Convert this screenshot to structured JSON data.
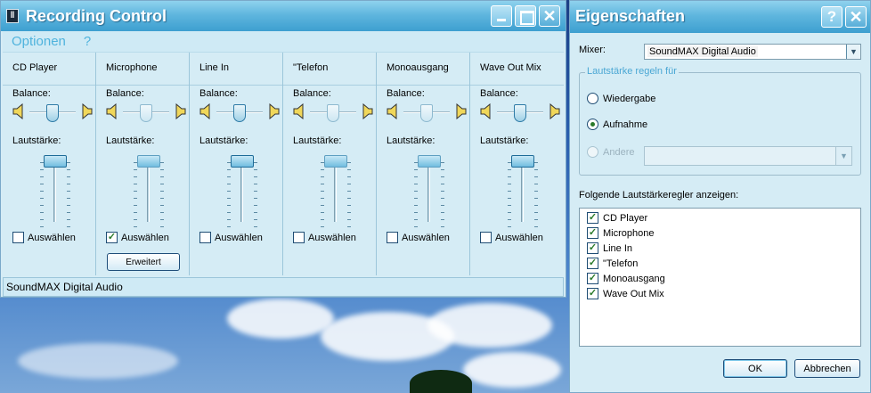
{
  "recording_control": {
    "title": "Recording Control",
    "menu": {
      "options": "Optionen",
      "help": "?"
    },
    "balance_label": "Balance:",
    "volume_label": "Lautstärke:",
    "select_label": "Auswählen",
    "advanced_button": "Erweitert",
    "status": "SoundMAX Digital Audio",
    "channels": [
      {
        "name": "CD Player",
        "selected": false
      },
      {
        "name": "Microphone",
        "selected": true
      },
      {
        "name": "Line In",
        "selected": false
      },
      {
        "name": "\"Telefon",
        "selected": false
      },
      {
        "name": "Monoausgang",
        "selected": false
      },
      {
        "name": "Wave Out Mix",
        "selected": false
      }
    ]
  },
  "properties": {
    "title": "Eigenschaften",
    "mixer_label": "Mixer:",
    "mixer_value": "SoundMAX Digital Audio",
    "group_title": "Lautstärke regeln für",
    "radio_playback": "Wiedergabe",
    "radio_record": "Aufnahme",
    "radio_other": "Andere",
    "selected_mode": "Aufnahme",
    "list_label": "Folgende Lautstärkeregler anzeigen:",
    "list_items": [
      {
        "label": "CD Player",
        "checked": true
      },
      {
        "label": "Microphone",
        "checked": true
      },
      {
        "label": "Line In",
        "checked": true
      },
      {
        "label": "\"Telefon",
        "checked": true
      },
      {
        "label": "Monoausgang",
        "checked": true
      },
      {
        "label": "Wave Out Mix",
        "checked": true
      }
    ],
    "ok_button": "OK",
    "cancel_button": "Abbrechen"
  },
  "icons": {
    "app": "mixer-app-icon",
    "minimize": "minimize-icon",
    "maximize": "maximize-icon",
    "close": "close-icon",
    "help": "help-icon",
    "speaker": "speaker-icon",
    "dropdown": "chevron-down-icon",
    "check": "checkmark-icon"
  },
  "colors": {
    "window_bg": "#d5ecf5",
    "titlebar": "#5fb6de",
    "menu_text": "#4fb3dd"
  }
}
